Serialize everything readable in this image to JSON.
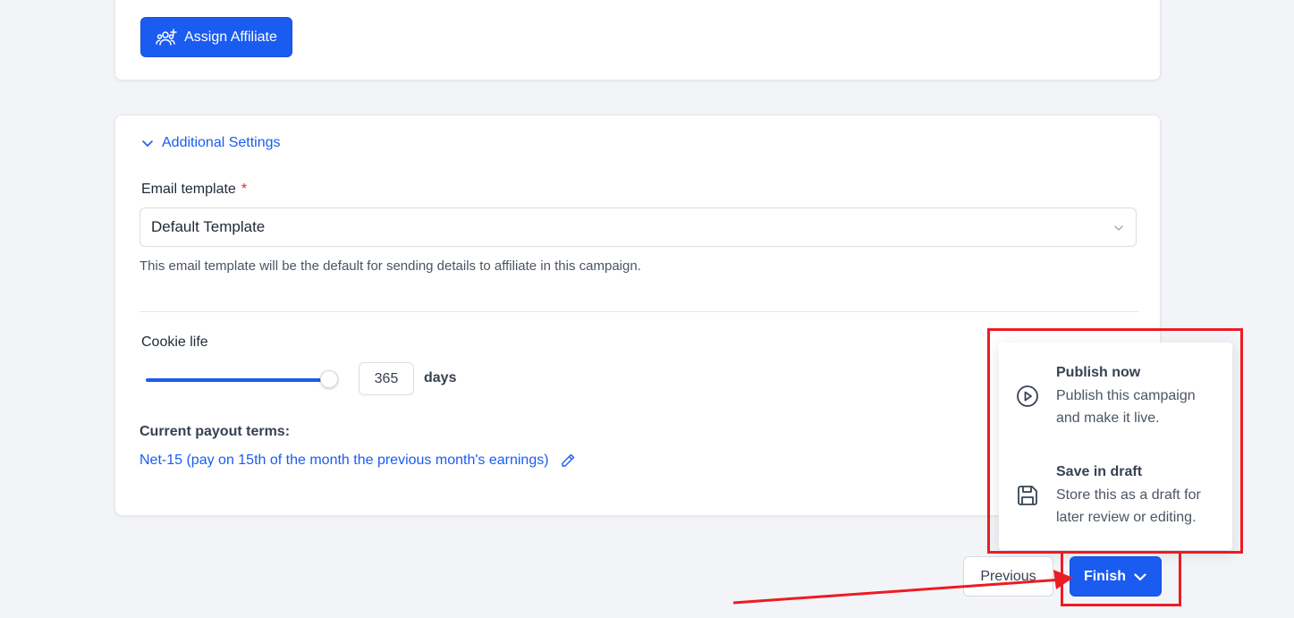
{
  "assign_button": {
    "label": "Assign Affiliate",
    "icon": "users-plus-icon"
  },
  "additional_settings": {
    "toggle_label": "Additional Settings",
    "email_template": {
      "label": "Email template",
      "required_mark": "*",
      "value": "Default Template",
      "help": "This email template will be the default for sending details to affiliate in this campaign."
    },
    "cookie_life": {
      "label": "Cookie life",
      "value": "365",
      "unit": "days",
      "slider_fraction": 1.0
    },
    "payout": {
      "label": "Current payout terms:",
      "value": "Net-15 (pay on 15th of the month the previous month's earnings)",
      "edit_icon": "pencil-icon"
    }
  },
  "finish_menu": {
    "items": [
      {
        "title": "Publish now",
        "description": "Publish this campaign and make it live.",
        "icon": "play-circle-icon"
      },
      {
        "title": "Save in draft",
        "description": "Store this as a draft for later review or editing.",
        "icon": "save-icon"
      }
    ]
  },
  "footer": {
    "previous_label": "Previous",
    "finish_label": "Finish"
  },
  "colors": {
    "primary": "#1a5cf0",
    "annotation": "#ec1c24",
    "background": "#f3f4f7"
  }
}
